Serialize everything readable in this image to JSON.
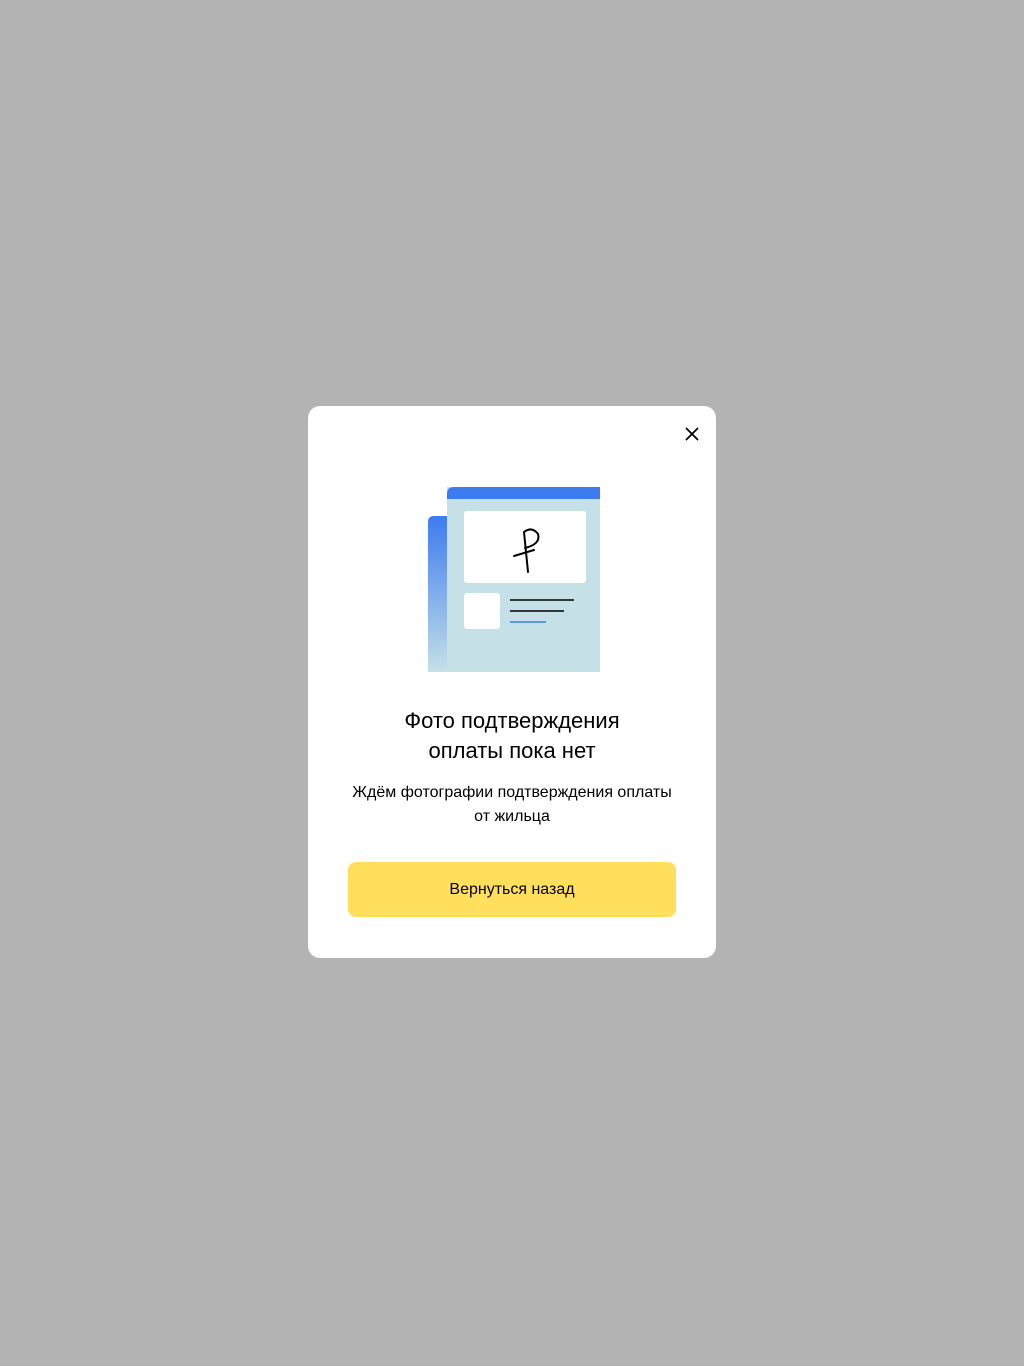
{
  "modal": {
    "close_icon": "close-icon",
    "illustration_icon": "payment-receipt-illustration",
    "title": "Фото подтверждения\nоплаты пока нет",
    "description": "Ждём фотографии подтверждения оплаты от жильца",
    "back_button_label": "Вернуться назад"
  },
  "colors": {
    "overlay": "#b3b3b3",
    "button": "#ffdf5c",
    "accent_blue": "#3d7bf0",
    "document_bg": "#c5e0e7"
  }
}
